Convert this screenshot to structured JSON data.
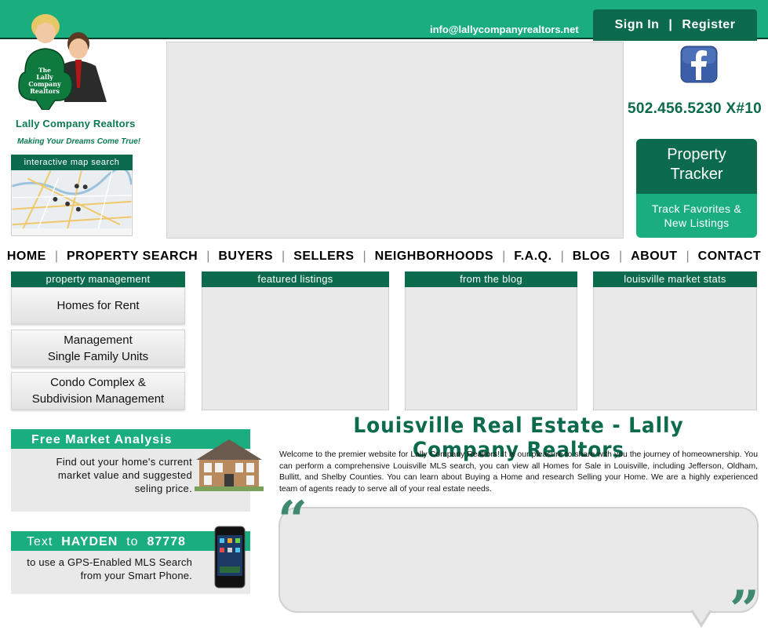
{
  "header": {
    "email": "info@lallycompanyrealtors.net",
    "sign_in": "Sign  In",
    "separator": "|",
    "register": "Register"
  },
  "brand": {
    "logo_text_1": "The",
    "logo_text_2": "Lally",
    "logo_text_3": "Company",
    "logo_text_4": "Realtors",
    "name": "Lally Company Realtors",
    "tagline": "Making Your Dreams Come True!"
  },
  "map": {
    "title": "interactive  map  search"
  },
  "contact": {
    "phone": "502.456.5230  X#10"
  },
  "tracker": {
    "title_line1": "Property",
    "title_line2": "Tracker",
    "sub_line1": "Track  Favorites  &",
    "sub_line2": "New  Listings"
  },
  "nav": {
    "items": [
      "HOME",
      "PROPERTY  SEARCH",
      "BUYERS",
      "SELLERS",
      "NEIGHBORHOODS",
      "F.A.Q.",
      "BLOG",
      "ABOUT",
      "CONTACT"
    ],
    "separator": "|"
  },
  "panels": {
    "property_management": "property  management",
    "featured_listings": "featured  listings",
    "from_the_blog": "from  the  blog",
    "market_stats": "louisville  market  stats"
  },
  "pm_buttons": {
    "rent": "Homes  for  Rent",
    "mgmt_line1": "Management",
    "mgmt_line2": "Single  Family  Units",
    "condo_line1": "Condo  Complex  &",
    "condo_line2": "Subdivision  Management"
  },
  "fma": {
    "title": "Free  Market  Analysis",
    "line1": "Find  out  your  home's  current",
    "line2": "market  value  and  suggested",
    "line3": "seling  price."
  },
  "text_promo": {
    "prefix": "Text",
    "keyword": "HAYDEN",
    "mid": "to",
    "number": "87778",
    "line1": "to  use  a  GPS-Enabled  MLS  Search",
    "line2": "from  your  Smart  Phone."
  },
  "main": {
    "title": "Louisville Real Estate - Lally Company Realtors",
    "intro": "Welcome to the premier website for Lally Company Realtors! It is our pleasure to share with you the journey of homeownership. You can perform a comprehensive Louisville MLS search, you can view all Homes for Sale in Louisville, including Jefferson, Oldham, Bullitt, and Shelby Counties. You can learn about Buying a Home and research Selling your Home. We are a highly experienced team of agents ready to serve all of your real estate needs."
  },
  "testimonial": {
    "open_quote": "“",
    "close_quote": "”"
  },
  "colors": {
    "accent": "#1aad7e",
    "dark_green": "#0b6b4c",
    "panel_bg": "#e9e9e9"
  }
}
